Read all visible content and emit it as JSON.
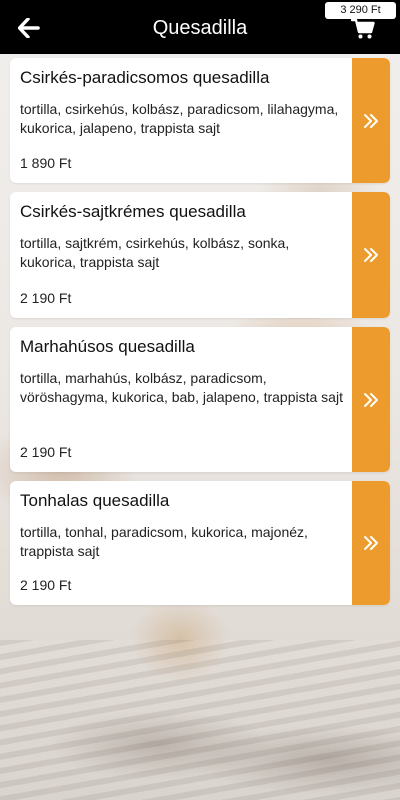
{
  "header": {
    "title": "Quesadilla",
    "back_icon": "arrow-left-icon",
    "cart_icon": "shopping-cart-icon",
    "cart_total": "3 290 Ft"
  },
  "colors": {
    "header_bg": "#000000",
    "accent": "#ec9b2c",
    "card_bg": "#ffffff"
  },
  "items": [
    {
      "name": "Csirkés-paradicsomos quesadilla",
      "ingredients": "tortilla, csirkehús, kolbász, paradicsom, lilahagyma, kukorica, jalapeno, trappista sajt",
      "price": "1 890 Ft",
      "button_icon": "double-chevron-right-icon"
    },
    {
      "name": "Csirkés-sajtkrémes quesadilla",
      "ingredients": "tortilla, sajtkrém, csirkehús, kolbász, sonka, kukorica, trappista sajt",
      "price": "2 190 Ft",
      "button_icon": "double-chevron-right-icon"
    },
    {
      "name": "Marhahúsos quesadilla",
      "ingredients": "tortilla, marhahús, kolbász, paradicsom, vöröshagyma, kukorica, bab, jalapeno, trappista sajt",
      "price": "2 190 Ft",
      "button_icon": "double-chevron-right-icon"
    },
    {
      "name": "Tonhalas quesadilla",
      "ingredients": "tortilla, tonhal, paradicsom, kukorica, majonéz, trappista sajt",
      "price": "2 190 Ft",
      "button_icon": "double-chevron-right-icon"
    }
  ]
}
